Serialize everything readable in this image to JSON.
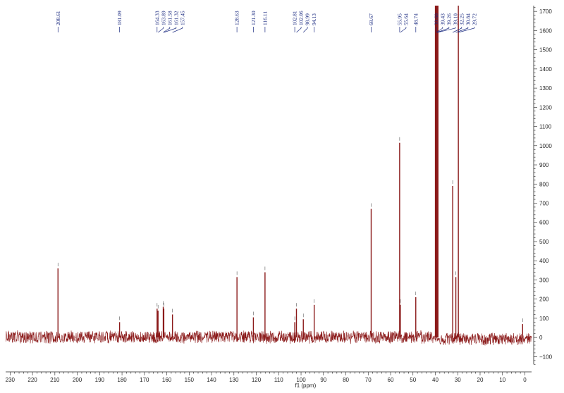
{
  "chart_data": {
    "type": "line",
    "xlabel": "f1 (ppm)",
    "ylabel": "",
    "xlim": [
      -3,
      232
    ],
    "ylim": [
      -150,
      1730
    ],
    "x_reversed": true,
    "x_ticks": [
      230,
      220,
      210,
      200,
      190,
      180,
      170,
      160,
      150,
      140,
      130,
      120,
      110,
      100,
      90,
      80,
      70,
      60,
      50,
      40,
      30,
      20,
      10,
      0
    ],
    "y_ticks": [
      -100,
      0,
      100,
      200,
      300,
      400,
      500,
      600,
      700,
      800,
      900,
      1000,
      1100,
      1200,
      1300,
      1400,
      1500,
      1600,
      1700
    ],
    "y_axis_side": "right",
    "grid": false,
    "line_color": "#8b1a1a",
    "label_color": "#1a2a80",
    "series": [
      {
        "values": [
          {
            "x": 208.61,
            "y": 360
          },
          {
            "x": 181.09,
            "y": 80
          },
          {
            "x": 164.33,
            "y": 150
          },
          {
            "x": 163.89,
            "y": 140
          },
          {
            "x": 161.58,
            "y": 160
          },
          {
            "x": 161.32,
            "y": 150
          },
          {
            "x": 157.45,
            "y": 120
          },
          {
            "x": 128.63,
            "y": 315
          },
          {
            "x": 121.3,
            "y": 105
          },
          {
            "x": 116.11,
            "y": 340
          },
          {
            "x": 102.81,
            "y": 80
          },
          {
            "x": 102.06,
            "y": 150
          },
          {
            "x": 98.99,
            "y": 95
          },
          {
            "x": 94.13,
            "y": 170
          },
          {
            "x": 68.67,
            "y": 670
          },
          {
            "x": 55.95,
            "y": 1015
          },
          {
            "x": 55.64,
            "y": 170
          },
          {
            "x": 48.74,
            "y": 210
          },
          {
            "x": 39.6,
            "y": 1730
          },
          {
            "x": 39.43,
            "y": 1730
          },
          {
            "x": 39.26,
            "y": 1730
          },
          {
            "x": 39.1,
            "y": 1730
          },
          {
            "x": 38.93,
            "y": 1730
          },
          {
            "x": 32.25,
            "y": 790
          },
          {
            "x": 30.84,
            "y": 315
          },
          {
            "x": 29.72,
            "y": 1730
          },
          {
            "x": 1.0,
            "y": 70
          }
        ]
      }
    ],
    "annotations": [
      {
        "x": 208.61,
        "text": "208.61"
      },
      {
        "x": 181.09,
        "text": "181.09"
      },
      {
        "x": 164.33,
        "text": "164.33"
      },
      {
        "x": 163.89,
        "text": "163.89"
      },
      {
        "x": 161.58,
        "text": "161.58"
      },
      {
        "x": 161.32,
        "text": "161.32"
      },
      {
        "x": 157.45,
        "text": "157.45"
      },
      {
        "x": 128.63,
        "text": "128.63"
      },
      {
        "x": 121.3,
        "text": "121.30"
      },
      {
        "x": 116.11,
        "text": "116.11"
      },
      {
        "x": 102.81,
        "text": "102.81"
      },
      {
        "x": 102.06,
        "text": "102.06"
      },
      {
        "x": 98.99,
        "text": "98.99"
      },
      {
        "x": 94.13,
        "text": "94.13"
      },
      {
        "x": 68.67,
        "text": "68.67"
      },
      {
        "x": 55.95,
        "text": "55.95"
      },
      {
        "x": 55.64,
        "text": "55.64"
      },
      {
        "x": 48.74,
        "text": "48.74"
      },
      {
        "x": 39.6,
        "text": "39.60"
      },
      {
        "x": 39.43,
        "text": "39.43"
      },
      {
        "x": 39.26,
        "text": "39.26"
      },
      {
        "x": 39.1,
        "text": "39.10"
      },
      {
        "x": 32.25,
        "text": "32.25"
      },
      {
        "x": 30.84,
        "text": "30.84"
      },
      {
        "x": 29.72,
        "text": "29.72"
      }
    ]
  }
}
